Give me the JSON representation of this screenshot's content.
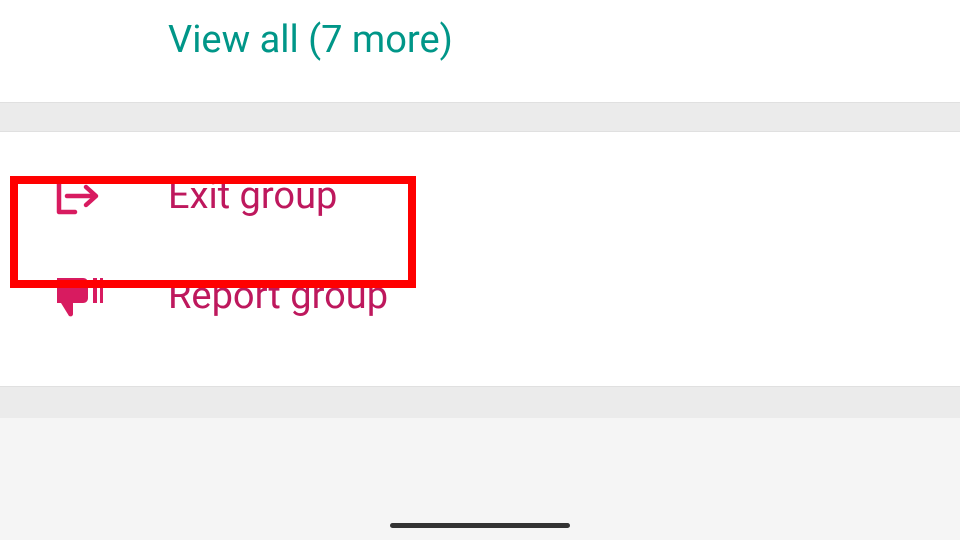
{
  "view_all": {
    "label": "View all (7 more)"
  },
  "actions": {
    "exit_group": {
      "label": "Exit group"
    },
    "report_group": {
      "label": "Report group"
    }
  },
  "colors": {
    "accent_green": "#009688",
    "danger_text": "#be185d",
    "danger_icon": "#d81b60",
    "highlight": "#ff0000"
  }
}
